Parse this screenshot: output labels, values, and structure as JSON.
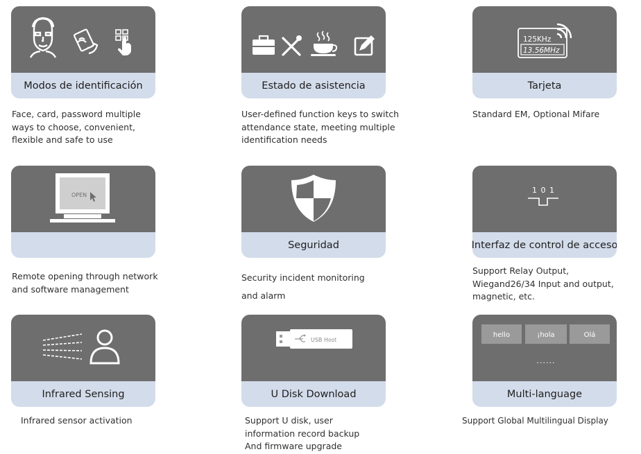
{
  "features": [
    {
      "caption": "Modos de identificación",
      "desc": [
        "Face, card, password multiple",
        "ways to choose, convenient,",
        "flexible and safe to use"
      ]
    },
    {
      "caption": "Estado de asistencia",
      "desc": [
        "User-defined function keys to switch",
        "attendance state, meeting multiple",
        "identification needs"
      ]
    },
    {
      "caption": "Tarjeta",
      "card_labels": [
        "125KHz",
        "13.56MHz"
      ],
      "desc": [
        "Standard EM, Optional Mifare"
      ]
    },
    {
      "caption": "",
      "screen_text": "OPEN",
      "desc": [
        "Remote opening through network",
        "and software management"
      ]
    },
    {
      "caption": "Seguridad",
      "desc": [
        "Security incident monitoring",
        "and alarm"
      ]
    },
    {
      "caption": "Interfaz de control de acceso",
      "signal_text": "1 0 1",
      "desc": [
        "Support Relay Output,",
        "Wiegand26/34 Input and output,",
        "magnetic, etc."
      ]
    },
    {
      "caption": "Infrared Sensing",
      "desc": [
        "Infrared sensor activation"
      ]
    },
    {
      "caption": "U Disk Download",
      "usb_text": "USB Host",
      "desc": [
        "Support U disk, user",
        "information record backup",
        "And firmware upgrade"
      ]
    },
    {
      "caption": "Multi-language",
      "languages": [
        "hello",
        "¡hola",
        "Olá"
      ],
      "more": "......",
      "desc": [
        "Support Global Multilingual Display"
      ]
    }
  ],
  "colors": {
    "card_top": "#6e6e6e",
    "card_caption": "#d3dcea",
    "icon": "#ffffff",
    "text": "#2f2f2f"
  }
}
